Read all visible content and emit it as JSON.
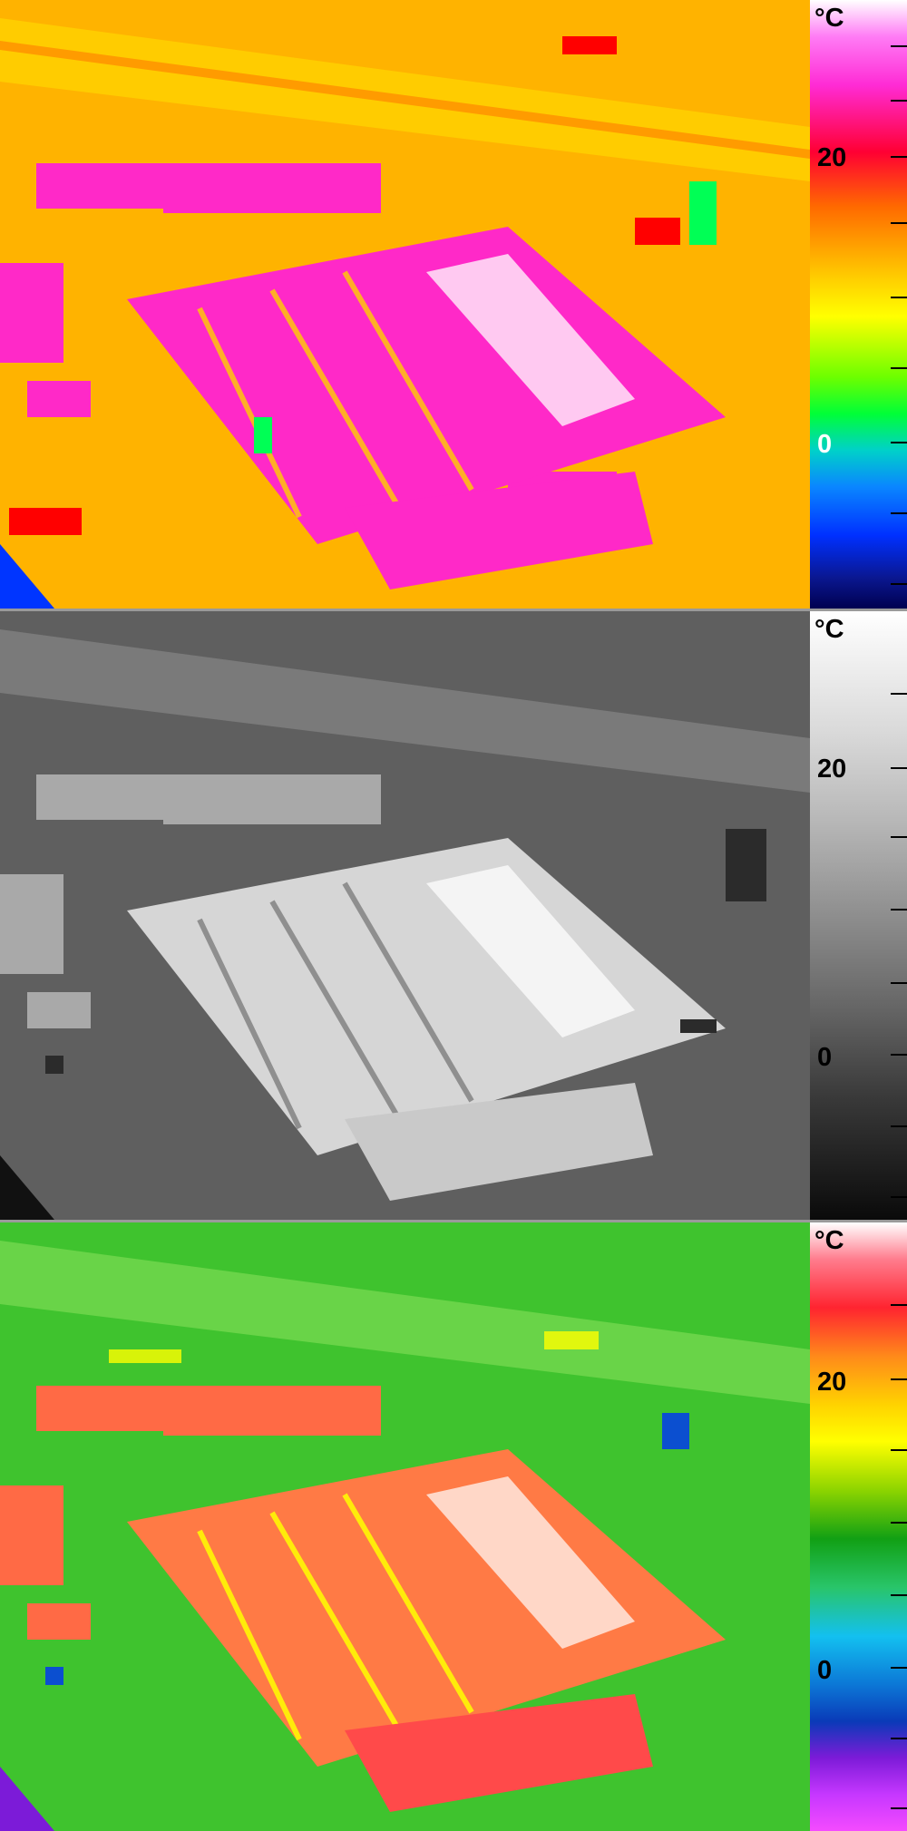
{
  "panels": [
    {
      "id": "rainbow",
      "scale": {
        "unit": "°C",
        "labels": {
          "high": "20",
          "low": "0"
        }
      },
      "colors": {
        "background": "#ffb300",
        "roof": "#ff29c8",
        "hot": "#ff2a6f",
        "warm": "#ffd000",
        "cool": "#00ff55",
        "cold": "#0035ff"
      }
    },
    {
      "id": "grayscale",
      "scale": {
        "unit": "°C",
        "labels": {
          "high": "20",
          "low": "0"
        }
      },
      "colors": {
        "background": "#5f5f5f",
        "roof": "#dfdfdf",
        "hot": "#cfcfcf",
        "warm": "#9a9a9a",
        "cool": "#464646",
        "cold": "#1b1b1b"
      }
    },
    {
      "id": "green-red",
      "scale": {
        "unit": "°C",
        "labels": {
          "high": "20",
          "low": "0"
        }
      },
      "colors": {
        "background": "#3fc32e",
        "roof": "#ff6a45",
        "hot": "#ff3d3d",
        "warm": "#ffff00",
        "cool": "#0ea04a",
        "cold": "#0b4fd0"
      }
    }
  ]
}
